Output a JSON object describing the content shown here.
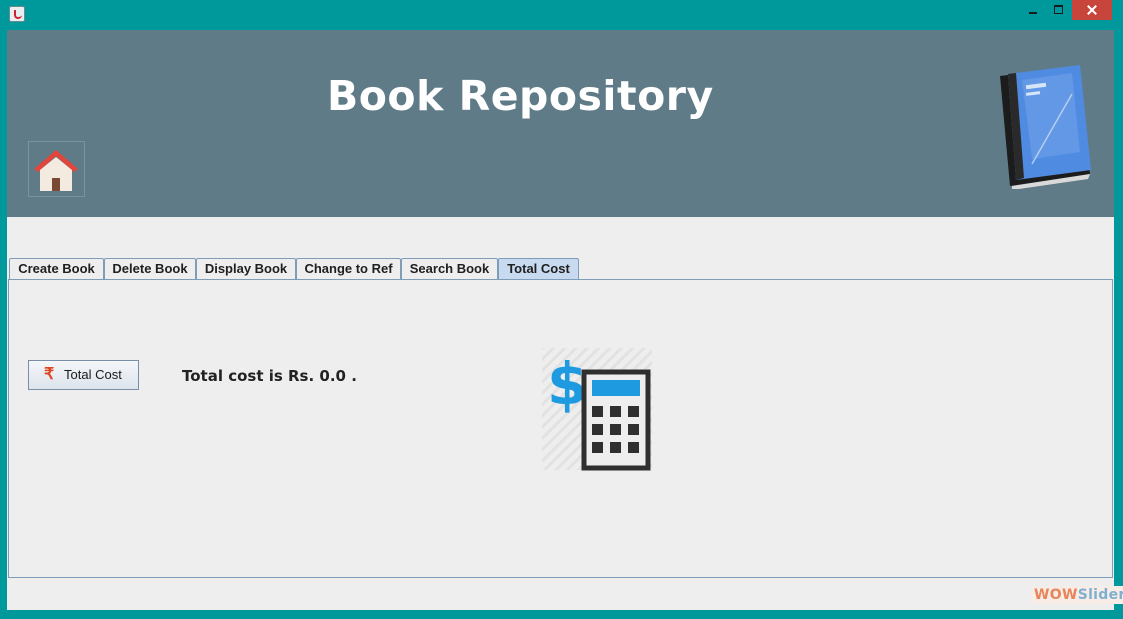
{
  "window": {
    "title_bar": {
      "minimize_icon": "minimize-icon",
      "maximize_icon": "maximize-icon",
      "close_icon": "close-icon"
    }
  },
  "header": {
    "title": "Book Repository",
    "home_icon": "home-icon",
    "logo_icon": "book-icon",
    "background_color": "#607b88"
  },
  "tabs": [
    {
      "label": "Create Book",
      "active": false
    },
    {
      "label": "Delete Book",
      "active": false
    },
    {
      "label": "Display Book",
      "active": false
    },
    {
      "label": "Change to Ref",
      "active": false
    },
    {
      "label": "Search Book",
      "active": false
    },
    {
      "label": "Total Cost",
      "active": true
    }
  ],
  "panel": {
    "total_cost_button": {
      "label": "Total Cost",
      "icon": "rupee-icon"
    },
    "result_text": "Total cost is Rs. 0.0 .",
    "illustration_icon": "calculator-dollar-icon"
  },
  "footer": {
    "badge": {
      "part1": "WOW",
      "part2": "Slider"
    }
  },
  "colors": {
    "accent_blue": "#1e9be0",
    "close_red": "#c7453a",
    "frame_teal": "#00999b"
  }
}
